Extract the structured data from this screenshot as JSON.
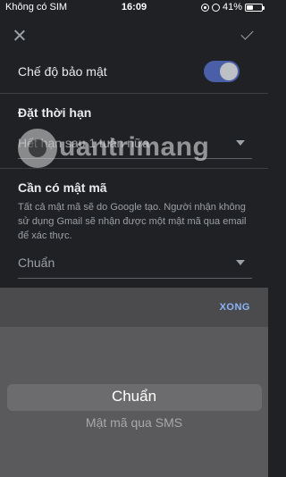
{
  "status_bar": {
    "carrier": "Không có SIM",
    "time": "16:09",
    "battery": "41%",
    "battery_level": 0.41
  },
  "top_bar": {
    "close_icon": "close-icon",
    "confirm_icon": "check-icon"
  },
  "confidential": {
    "label": "Chế độ bảo mật",
    "enabled": true,
    "accent": "#4a5fa8"
  },
  "expiry": {
    "title": "Đặt thời hạn",
    "value": "Hết hạn sau 1 tuần nữa"
  },
  "passcode": {
    "title": "Cần có mật mã",
    "description": "Tất cả mật mã sẽ do Google tạo. Người nhận không sử dụng Gmail sẽ nhận được một mật mã qua email để xác thực.",
    "value": "Chuẩn"
  },
  "picker": {
    "done_label": "XONG",
    "options": [
      "Chuẩn",
      "Mật mã qua SMS"
    ],
    "selected_index": 0
  },
  "watermark": {
    "text": "uantrimang"
  }
}
